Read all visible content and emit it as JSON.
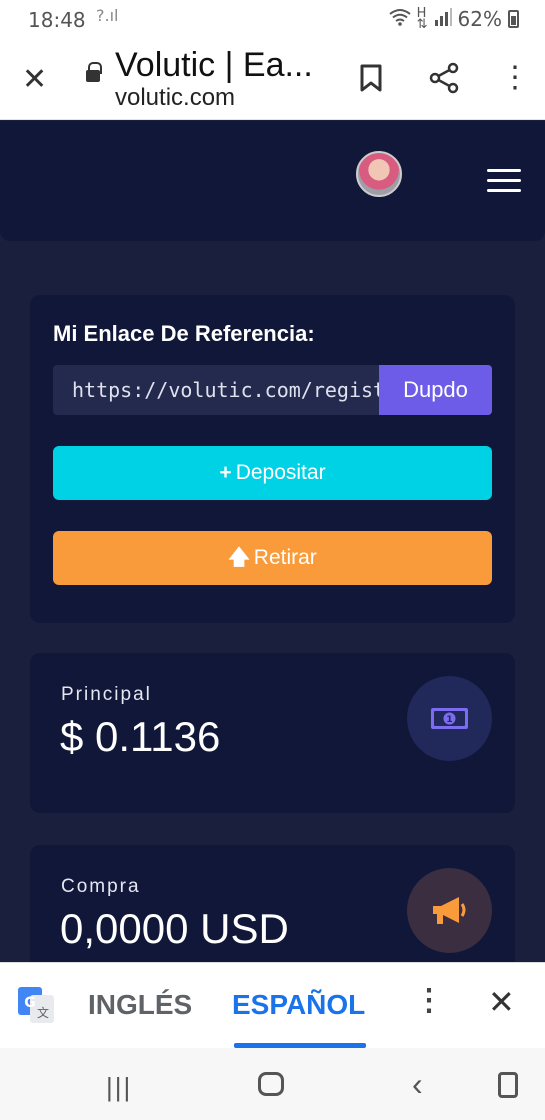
{
  "status_bar": {
    "time": "18:48",
    "signal_left": "?.ıl",
    "battery": "62%"
  },
  "browser": {
    "title": "Volutic | Ea...",
    "url": "volutic.com"
  },
  "referral": {
    "title": "Mi Enlace De Referencia:",
    "link": "https://volutic.com/register?ref=",
    "copy_label": "Dupdo"
  },
  "actions": {
    "deposit_label": "Depositar",
    "withdraw_label": "Retirar"
  },
  "stats": [
    {
      "label": "Principal",
      "value": "$ 0.1136",
      "icon": "banknote-icon"
    },
    {
      "label": "Compra",
      "value": "0,0000 USD",
      "icon": "megaphone-icon"
    }
  ],
  "translate_bar": {
    "source_lang": "INGLÉS",
    "target_lang": "ESPAÑOL"
  },
  "colors": {
    "primary": "#6c5ce7",
    "deposit": "#00d2e6",
    "withdraw": "#f99b3b",
    "card_bg": "#111738",
    "page_bg": "#1a1f3d"
  }
}
